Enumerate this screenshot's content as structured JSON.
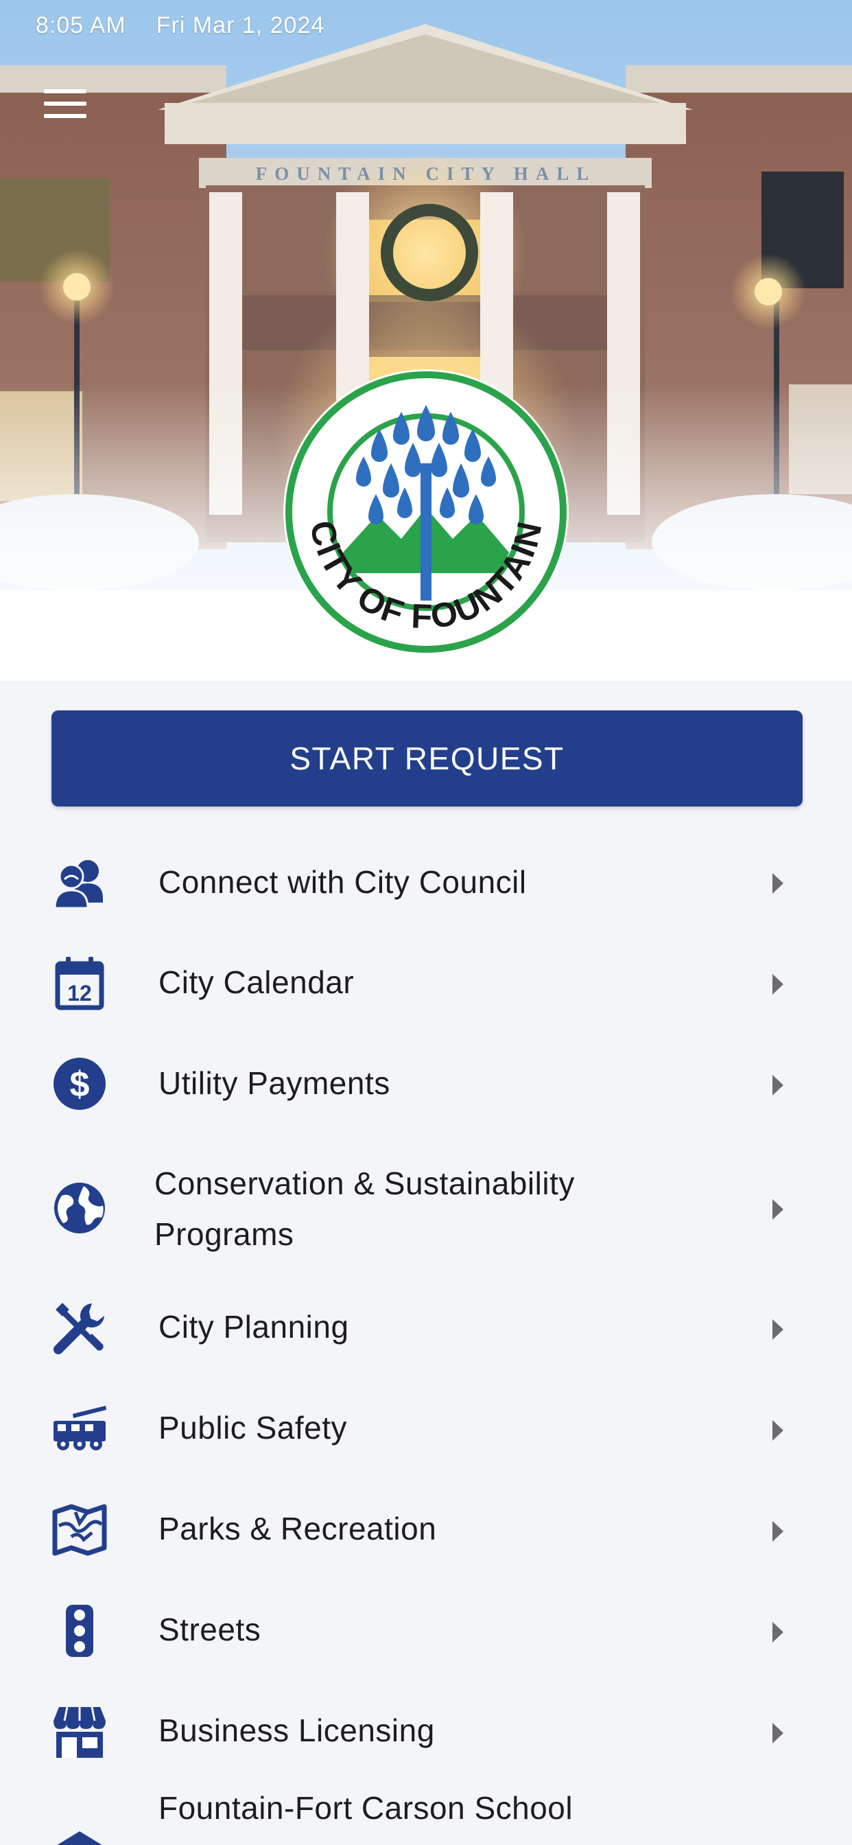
{
  "status_bar": {
    "time": "8:05 AM",
    "date": "Fri Mar 1, 2024"
  },
  "hero": {
    "building_sign": "FOUNTAIN CITY HALL",
    "logo_text": "CITY OF FOUNTAIN",
    "logo_colors": {
      "ring": "#2aa34a",
      "fountain": "#2f6fc0",
      "mountains": "#2aa34a",
      "text": "#1a1a1a"
    }
  },
  "start_request": {
    "label": "START REQUEST"
  },
  "menu": {
    "items": [
      {
        "label": "Connect with City Council",
        "icon": "people-icon"
      },
      {
        "label": "City Calendar",
        "icon": "calendar-icon"
      },
      {
        "label": "Utility Payments",
        "icon": "dollar-icon"
      },
      {
        "label_line1": "Conservation & Sustainability",
        "label_line2": "Programs",
        "icon": "globe-icon"
      },
      {
        "label": "City Planning",
        "icon": "tools-icon"
      },
      {
        "label": "Public Safety",
        "icon": "fire-truck-icon"
      },
      {
        "label": "Parks & Recreation",
        "icon": "map-icon"
      },
      {
        "label": "Streets",
        "icon": "traffic-light-icon"
      },
      {
        "label": "Business Licensing",
        "icon": "store-icon"
      },
      {
        "label": "Fountain-Fort Carson School",
        "icon": "school-icon"
      }
    ]
  },
  "colors": {
    "primary": "#233f8c",
    "icon": "#233f8c",
    "background": "#f4f5f8",
    "text": "#1c1c22"
  }
}
